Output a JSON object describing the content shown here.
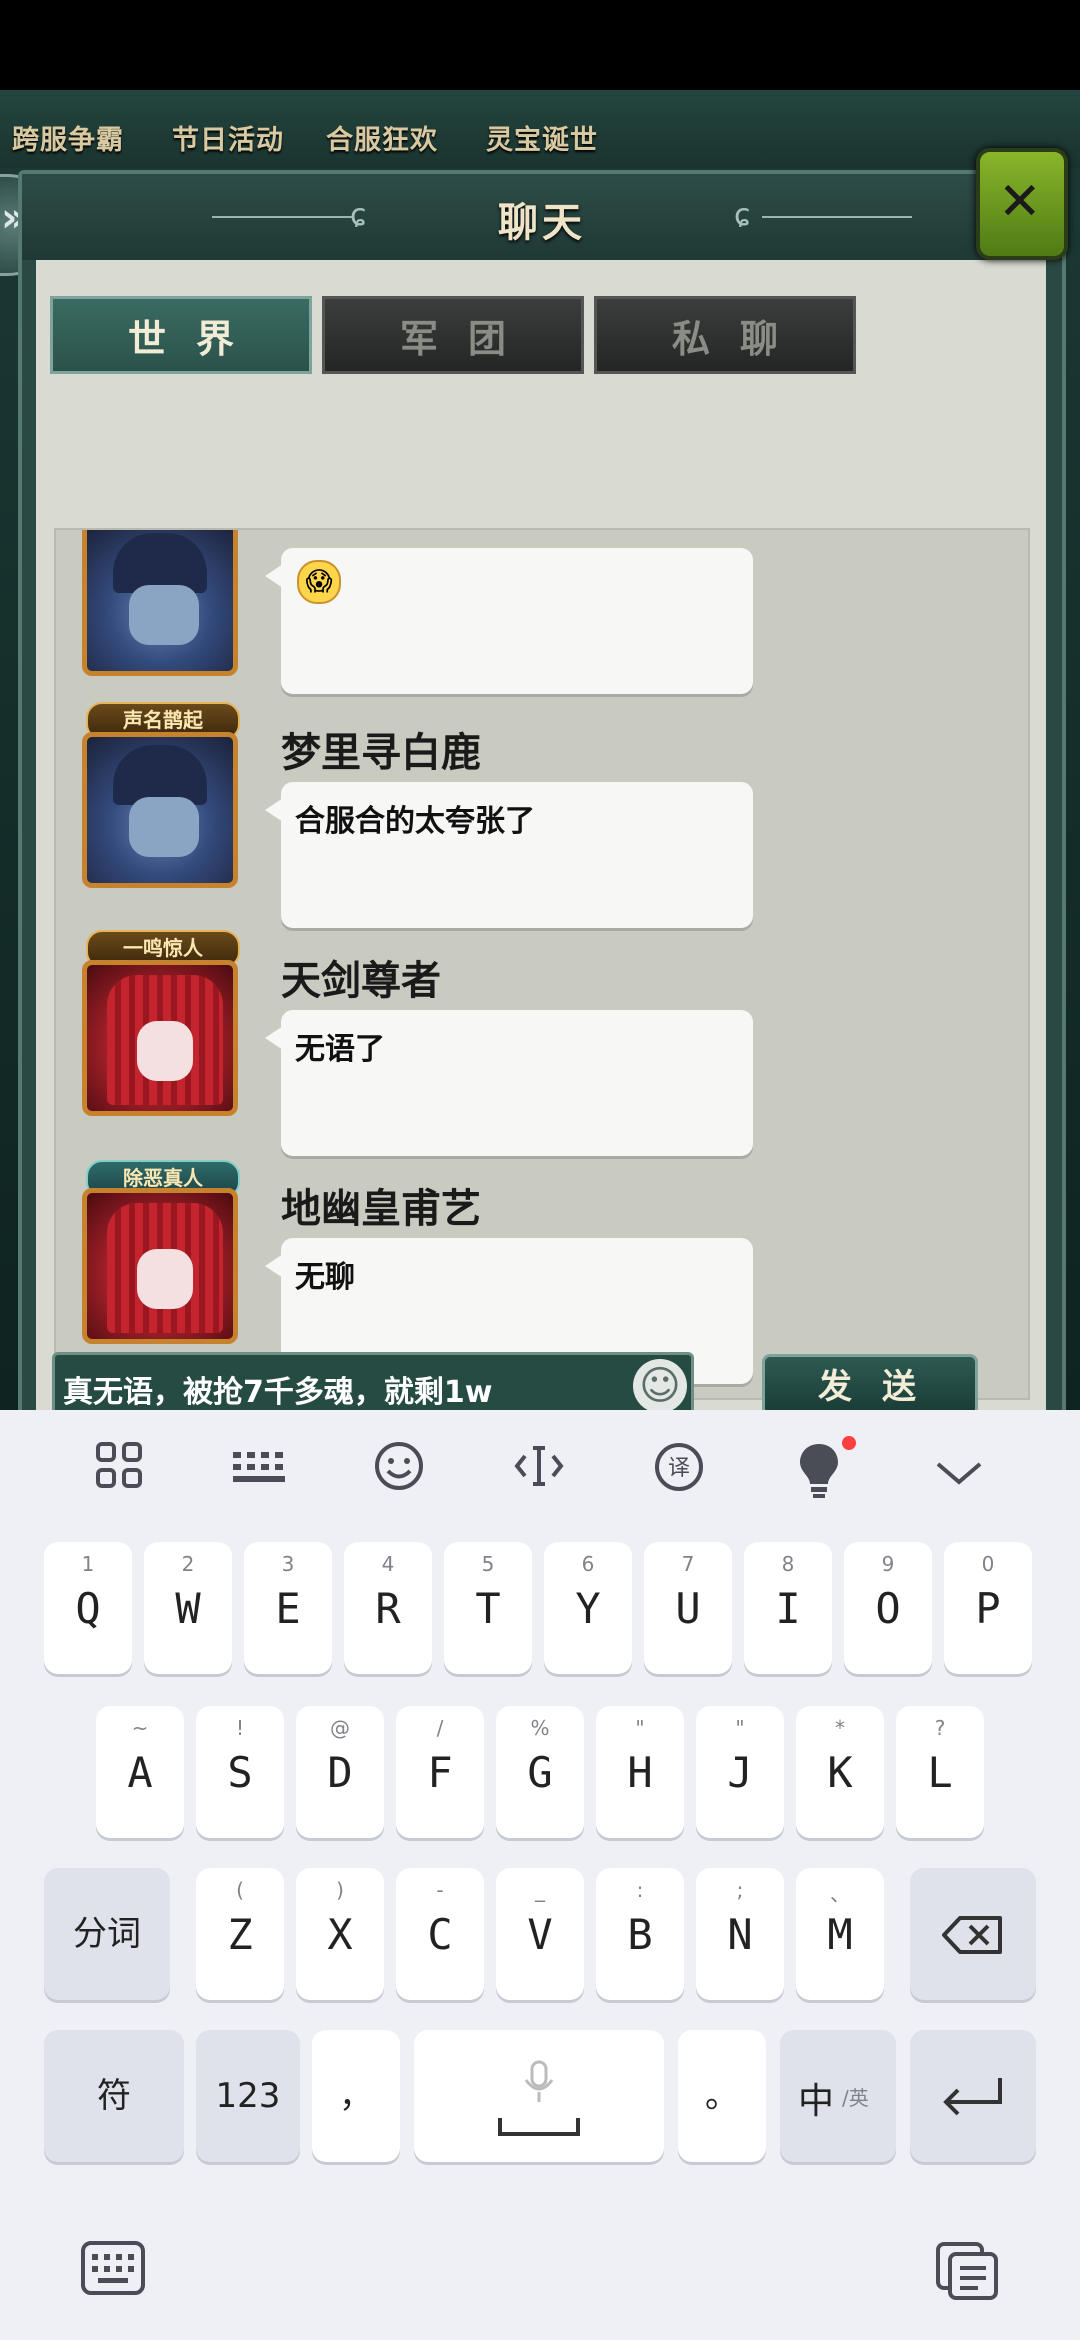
{
  "topnav": {
    "items": [
      "跨服争霸",
      "节日活动",
      "合服狂欢",
      "灵宝诞世"
    ]
  },
  "panel": {
    "title": "聊天",
    "close_symbol": "✕"
  },
  "tabs": [
    {
      "label": "世界",
      "active": true
    },
    {
      "label": "军团",
      "active": false
    },
    {
      "label": "私聊",
      "active": false
    }
  ],
  "messages": [
    {
      "name": "",
      "badge": "",
      "text": "",
      "avatar": "blue-zombie",
      "emoji": "😱"
    },
    {
      "name": "梦里寻白鹿",
      "badge": "声名鹊起",
      "text": "合服合的太夸张了",
      "avatar": "blue-zombie"
    },
    {
      "name": "天剑尊者",
      "badge": "一鸣惊人",
      "text": "无语了",
      "avatar": "red-bride"
    },
    {
      "name": "地幽皇甫艺",
      "badge": "除恶真人",
      "text": "无聊",
      "avatar": "red-bride"
    }
  ],
  "input": {
    "value": "真无语，被抢7千多魂，就剩1w",
    "smiley": "☺"
  },
  "send_button": {
    "label": "发送"
  },
  "keyboard": {
    "toolbar_icons": [
      "grid-icon",
      "keyboard-layout-icon",
      "emoji-face-icon",
      "cursor-icon",
      "translate-icon",
      "lightbulb-ad-icon",
      "collapse-chevron-icon"
    ],
    "row1": [
      {
        "sub": "1",
        "key": "Q"
      },
      {
        "sub": "2",
        "key": "W"
      },
      {
        "sub": "3",
        "key": "E"
      },
      {
        "sub": "4",
        "key": "R"
      },
      {
        "sub": "5",
        "key": "T"
      },
      {
        "sub": "6",
        "key": "Y"
      },
      {
        "sub": "7",
        "key": "U"
      },
      {
        "sub": "8",
        "key": "I"
      },
      {
        "sub": "9",
        "key": "O"
      },
      {
        "sub": "0",
        "key": "P"
      }
    ],
    "row2": [
      {
        "sub": "~",
        "key": "A"
      },
      {
        "sub": "!",
        "key": "S"
      },
      {
        "sub": "@",
        "key": "D"
      },
      {
        "sub": "/",
        "key": "F"
      },
      {
        "sub": "%",
        "key": "G"
      },
      {
        "sub": "\"",
        "key": "H"
      },
      {
        "sub": "\"",
        "key": "J"
      },
      {
        "sub": "*",
        "key": "K"
      },
      {
        "sub": "?",
        "key": "L"
      }
    ],
    "row3": [
      {
        "sub": "(",
        "key": "Z"
      },
      {
        "sub": ")",
        "key": "X"
      },
      {
        "sub": "-",
        "key": "C"
      },
      {
        "sub": "_",
        "key": "V"
      },
      {
        "sub": ":",
        "key": "B"
      },
      {
        "sub": ";",
        "key": "N"
      },
      {
        "sub": "、",
        "key": "M"
      }
    ],
    "segment_key": "分词",
    "symbol_key": "符",
    "num_key": "123",
    "comma_key": "，",
    "period_key": "。",
    "lang_key": "中",
    "lang_alt": "/英"
  }
}
